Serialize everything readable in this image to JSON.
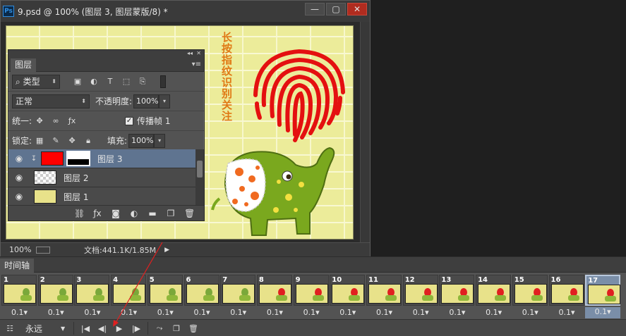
{
  "window": {
    "app_logo": "Ps",
    "title": "9.psd @ 100% (图层 3, 图层蒙版/8) *",
    "btn_minimize": "—",
    "btn_maximize": "▢",
    "btn_close": "✕"
  },
  "status": {
    "zoom": "100%",
    "doc_info": "文档:441.1K/1.85M",
    "arrow": "▶"
  },
  "canvas_text": "长按指纹识别关注",
  "layers_panel": {
    "collapse": "◂◂",
    "close": "✕",
    "tab": "图层",
    "menu": "▾≡",
    "filter_label": "类型",
    "blend_mode": "正常",
    "opacity_label": "不透明度:",
    "opacity_value": "100%",
    "unify_label": "统一:",
    "propagate_label": "传播帧 1",
    "propagate_checked": "✓",
    "lock_label": "锁定:",
    "fill_label": "填充:",
    "fill_value": "100%",
    "layers": [
      {
        "name": "图层 3",
        "selected": true,
        "thumb": "red"
      },
      {
        "name": "图层 2",
        "selected": false,
        "thumb": "trans"
      },
      {
        "name": "图层 1",
        "selected": false,
        "thumb": "yellow"
      }
    ]
  },
  "timeline": {
    "tab": "时间轴",
    "frames": [
      {
        "num": "1",
        "delay": "0.1▾"
      },
      {
        "num": "2",
        "delay": "0.1▾"
      },
      {
        "num": "3",
        "delay": "0.1▾"
      },
      {
        "num": "4",
        "delay": "0.1▾"
      },
      {
        "num": "5",
        "delay": "0.1▾"
      },
      {
        "num": "6",
        "delay": "0.1▾"
      },
      {
        "num": "7",
        "delay": "0.1▾"
      },
      {
        "num": "8",
        "delay": "0.1▾"
      },
      {
        "num": "9",
        "delay": "0.1▾"
      },
      {
        "num": "10",
        "delay": "0.1▾"
      },
      {
        "num": "11",
        "delay": "0.1▾"
      },
      {
        "num": "12",
        "delay": "0.1▾"
      },
      {
        "num": "13",
        "delay": "0.1▾"
      },
      {
        "num": "14",
        "delay": "0.1▾"
      },
      {
        "num": "15",
        "delay": "0.1▾"
      },
      {
        "num": "16",
        "delay": "0.1▾"
      },
      {
        "num": "17",
        "delay": "0.1▾"
      }
    ],
    "selected_frame": "17",
    "loop": "永远"
  }
}
